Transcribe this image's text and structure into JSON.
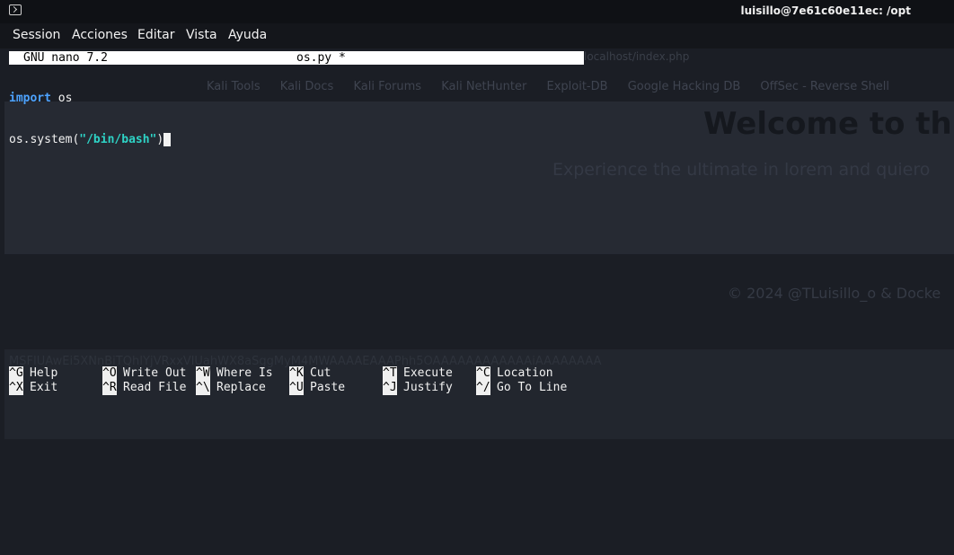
{
  "window": {
    "title": "luisillo@7e61c60e11ec: /opt"
  },
  "menu": [
    "Session",
    "Acciones",
    "Editar",
    "Vista",
    "Ayuda"
  ],
  "nano": {
    "version": "GNU nano 7.2",
    "filename": "os.py *",
    "code": {
      "line1_keyword": "import",
      "line1_rest": " os",
      "line2_call": "os.system(",
      "line2_string": "\"/bin/bash\"",
      "line2_close": ")"
    },
    "shortcuts": [
      {
        "key": "^G",
        "label": "Help"
      },
      {
        "key": "^O",
        "label": "Write Out"
      },
      {
        "key": "^W",
        "label": "Where Is"
      },
      {
        "key": "^K",
        "label": "Cut"
      },
      {
        "key": "^T",
        "label": "Execute"
      },
      {
        "key": "^C",
        "label": "Location"
      },
      {
        "key": "^X",
        "label": "Exit"
      },
      {
        "key": "^R",
        "label": "Read File"
      },
      {
        "key": "^\\",
        "label": "Replace"
      },
      {
        "key": "^U",
        "label": "Paste"
      },
      {
        "key": "^J",
        "label": "Justify"
      },
      {
        "key": "^/",
        "label": "Go To Line"
      }
    ]
  },
  "background": {
    "url": "localhost/index.php",
    "bookmarks": [
      "Kali Tools",
      "Kali Docs",
      "Kali Forums",
      "Kali NetHunter",
      "Exploit-DB",
      "Google Hacking DB",
      "OffSec - Reverse Shell"
    ],
    "hero_title": "Welcome to this",
    "hero_subtitle": "Experience the ultimate in lorem and quiero",
    "footer": "© 2024 @TLuisillo_o & Docke",
    "noise": "MSFIUAwEi5XNnBiTQhIYjVRxxVlUahWX8aSggMyM4MWAAAAEAAAPhh5OAAAAAAAAAAAAiAAAAAAAA"
  },
  "colors": {
    "keyword": "#4da3ff",
    "string": "#2ed3c6",
    "header_bg": "#ffffff"
  }
}
